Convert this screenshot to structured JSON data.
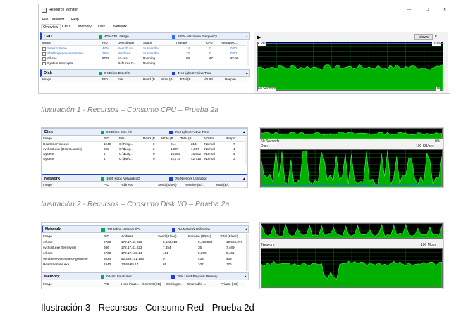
{
  "window": {
    "title": "Resource Monitor",
    "controls": [
      "—",
      "☐",
      "✕"
    ],
    "menu": [
      "File",
      "Monitor",
      "Help"
    ],
    "tabs": [
      "Overview",
      "CPU",
      "Memory",
      "Disk",
      "Network"
    ],
    "active_tab": "Overview",
    "views_button": "Views"
  },
  "colors": {
    "green": "#00b050",
    "blue": "#1f3fd0",
    "chart_bg": "#000000",
    "chart_green": "#00c800",
    "chart_blue": "#2c6cff"
  },
  "fig1": {
    "cpu_section": {
      "name": "CPU",
      "stat1": "47% CPU Usage",
      "stat2": "100% Maximum Frequency"
    },
    "cpu_columns": [
      "Image",
      "PID",
      "Description",
      "Status",
      "Threads",
      "CPU",
      "Average C..."
    ],
    "cpu_rows": [
      [
        "SearchUI.exe",
        "4404",
        "Search an...",
        "Suspended",
        "14",
        "0",
        "0.00"
      ],
      [
        "ShellExperienceHost.exe",
        "2684",
        "Windows ...",
        "Suspended",
        "32",
        "0",
        "0.00"
      ],
      [
        "erl.exe",
        "5720",
        "erl.exe",
        "Running",
        "88",
        "37",
        "37.46"
      ],
      [
        "System Interrupts",
        "-",
        "Deferred P...",
        "Running",
        "-",
        "",
        ""
      ]
    ],
    "disk_section": {
      "name": "Disk",
      "stat1": "0 KB/sec Disk I/O",
      "stat2": "4% Highest Active Time"
    },
    "disk_columns": [
      "Image",
      "PID",
      "File",
      "Read (B...",
      "Write (B...",
      "Total (B...",
      "I/O Pri...",
      "Respon..."
    ],
    "chart_top": {
      "name": "CPU",
      "max": "100%"
    },
    "chart_bottom": {
      "name": "60 Seconds",
      "min": "0%"
    }
  },
  "caption1": "Ilustración 1 - Recursos – Consumo CPU – Prueba 2a",
  "fig2": {
    "disk_section": {
      "name": "Disk",
      "stat1": "0 KB/sec Disk I/O",
      "stat2": "0% Highest Active Time"
    },
    "disk_columns": [
      "Image",
      "PID",
      "File",
      "Read (B...",
      "Write (B...",
      "Total (B...",
      "I/O Pri...",
      "Respo..."
    ],
    "disk_rows": [
      [
        "HealthService.exe",
        "1940",
        "C:\\Prog...",
        "0",
        "214",
        "214",
        "Normal",
        "7"
      ],
      [
        "svchost.exe (DcomLaunch)",
        "692",
        "C:\\$Log...",
        "0",
        "1,507",
        "1,507",
        "Normal",
        "4"
      ],
      [
        "System",
        "4",
        "C:\\$Log...",
        "0",
        "15,502",
        "15,502",
        "Normal",
        "4"
      ],
      [
        "System",
        "4",
        "C:\\$Mft...",
        "0",
        "42,715",
        "42,715",
        "Normal",
        "3"
      ]
    ],
    "network_section": {
      "name": "Network",
      "stat1": "1085 Kbps Network I/O",
      "stat2": "0% Network Utilization"
    },
    "network_columns": [
      "Image",
      "PID",
      "Address",
      "Send (B/sec)",
      "Receive (B/...",
      "Total (B/..."
    ],
    "chart_top": {
      "name": "60 Seconds",
      "min": "0%"
    },
    "chart_bottom": {
      "name": "Disk",
      "max": "100 KB/sec"
    }
  },
  "caption2": "Ilustración 2 - Recursos – Consumo Disk I/O – Prueba 2a",
  "fig3": {
    "network_section": {
      "name": "Network",
      "stat1": "101 Mbps Network I/O",
      "stat2": "0% Network Utilization"
    },
    "network_columns": [
      "Image",
      "PID",
      "Address",
      "Send (B/sec)",
      "Receive (B/sec)",
      "Total (B/sec)"
    ],
    "network_rows": [
      [
        "erl.exe",
        "5720",
        "172.17.41.223",
        "5,523,716",
        "5,428,560",
        "10,952,277"
      ],
      [
        "svchost.exe (termsvcs)",
        "936",
        "172.17.41.223",
        "7,454",
        "35",
        "7,489"
      ],
      [
        "erl.exe",
        "5720",
        "172.17.133.14",
        "401",
        "5,090",
        "5,491"
      ],
      [
        "WindowsAzureGuestAgent.exe",
        "2024",
        "52.239.141.196",
        "0",
        "433",
        "433"
      ],
      [
        "HealthService.exe",
        "1940",
        "13.69.65.17",
        "69",
        "107",
        "175"
      ]
    ],
    "memory_section": {
      "name": "Memory",
      "stat1": "0 Hard Faults/sec",
      "stat2": "28% Used Physical Memory"
    },
    "memory_columns": [
      "Image",
      "PID",
      "Hard Fault...",
      "Commit (KB)",
      "Working S...",
      "Shareable ...",
      "Private (KB)"
    ],
    "chart_bottom": {
      "name": "Network",
      "max": "100 Mbps"
    }
  },
  "caption3": "Ilustración 3 - Recursos - Consumo Red - Prueba 2d"
}
